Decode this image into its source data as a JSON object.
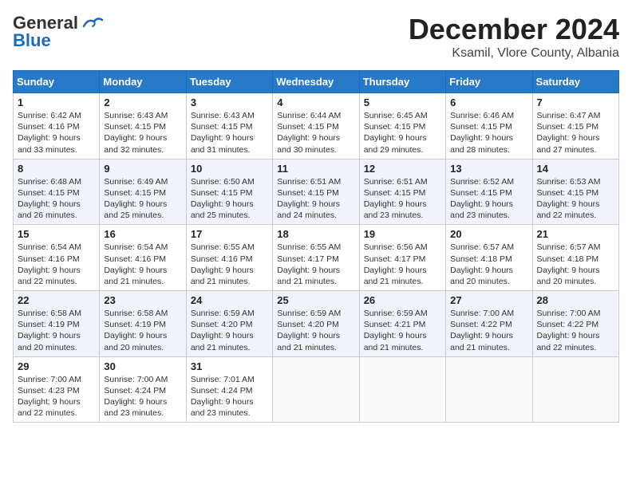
{
  "header": {
    "logo": {
      "line1": "General",
      "line2": "Blue"
    },
    "title": "December 2024",
    "subtitle": "Ksamil, Vlore County, Albania"
  },
  "calendar": {
    "weekdays": [
      "Sunday",
      "Monday",
      "Tuesday",
      "Wednesday",
      "Thursday",
      "Friday",
      "Saturday"
    ],
    "weeks": [
      [
        {
          "day": "",
          "info": ""
        },
        {
          "day": "2",
          "info": "Sunrise: 6:43 AM\nSunset: 4:15 PM\nDaylight: 9 hours\nand 32 minutes."
        },
        {
          "day": "3",
          "info": "Sunrise: 6:43 AM\nSunset: 4:15 PM\nDaylight: 9 hours\nand 31 minutes."
        },
        {
          "day": "4",
          "info": "Sunrise: 6:44 AM\nSunset: 4:15 PM\nDaylight: 9 hours\nand 30 minutes."
        },
        {
          "day": "5",
          "info": "Sunrise: 6:45 AM\nSunset: 4:15 PM\nDaylight: 9 hours\nand 29 minutes."
        },
        {
          "day": "6",
          "info": "Sunrise: 6:46 AM\nSunset: 4:15 PM\nDaylight: 9 hours\nand 28 minutes."
        },
        {
          "day": "7",
          "info": "Sunrise: 6:47 AM\nSunset: 4:15 PM\nDaylight: 9 hours\nand 27 minutes."
        }
      ],
      [
        {
          "day": "1",
          "info": "Sunrise: 6:42 AM\nSunset: 4:16 PM\nDaylight: 9 hours\nand 33 minutes."
        },
        {
          "day": "9",
          "info": "Sunrise: 6:49 AM\nSunset: 4:15 PM\nDaylight: 9 hours\nand 25 minutes."
        },
        {
          "day": "10",
          "info": "Sunrise: 6:50 AM\nSunset: 4:15 PM\nDaylight: 9 hours\nand 25 minutes."
        },
        {
          "day": "11",
          "info": "Sunrise: 6:51 AM\nSunset: 4:15 PM\nDaylight: 9 hours\nand 24 minutes."
        },
        {
          "day": "12",
          "info": "Sunrise: 6:51 AM\nSunset: 4:15 PM\nDaylight: 9 hours\nand 23 minutes."
        },
        {
          "day": "13",
          "info": "Sunrise: 6:52 AM\nSunset: 4:15 PM\nDaylight: 9 hours\nand 23 minutes."
        },
        {
          "day": "14",
          "info": "Sunrise: 6:53 AM\nSunset: 4:15 PM\nDaylight: 9 hours\nand 22 minutes."
        }
      ],
      [
        {
          "day": "8",
          "info": "Sunrise: 6:48 AM\nSunset: 4:15 PM\nDaylight: 9 hours\nand 26 minutes."
        },
        {
          "day": "16",
          "info": "Sunrise: 6:54 AM\nSunset: 4:16 PM\nDaylight: 9 hours\nand 21 minutes."
        },
        {
          "day": "17",
          "info": "Sunrise: 6:55 AM\nSunset: 4:16 PM\nDaylight: 9 hours\nand 21 minutes."
        },
        {
          "day": "18",
          "info": "Sunrise: 6:55 AM\nSunset: 4:17 PM\nDaylight: 9 hours\nand 21 minutes."
        },
        {
          "day": "19",
          "info": "Sunrise: 6:56 AM\nSunset: 4:17 PM\nDaylight: 9 hours\nand 21 minutes."
        },
        {
          "day": "20",
          "info": "Sunrise: 6:57 AM\nSunset: 4:18 PM\nDaylight: 9 hours\nand 20 minutes."
        },
        {
          "day": "21",
          "info": "Sunrise: 6:57 AM\nSunset: 4:18 PM\nDaylight: 9 hours\nand 20 minutes."
        }
      ],
      [
        {
          "day": "15",
          "info": "Sunrise: 6:54 AM\nSunset: 4:16 PM\nDaylight: 9 hours\nand 22 minutes."
        },
        {
          "day": "23",
          "info": "Sunrise: 6:58 AM\nSunset: 4:19 PM\nDaylight: 9 hours\nand 20 minutes."
        },
        {
          "day": "24",
          "info": "Sunrise: 6:59 AM\nSunset: 4:20 PM\nDaylight: 9 hours\nand 21 minutes."
        },
        {
          "day": "25",
          "info": "Sunrise: 6:59 AM\nSunset: 4:20 PM\nDaylight: 9 hours\nand 21 minutes."
        },
        {
          "day": "26",
          "info": "Sunrise: 6:59 AM\nSunset: 4:21 PM\nDaylight: 9 hours\nand 21 minutes."
        },
        {
          "day": "27",
          "info": "Sunrise: 7:00 AM\nSunset: 4:22 PM\nDaylight: 9 hours\nand 21 minutes."
        },
        {
          "day": "28",
          "info": "Sunrise: 7:00 AM\nSunset: 4:22 PM\nDaylight: 9 hours\nand 22 minutes."
        }
      ],
      [
        {
          "day": "22",
          "info": "Sunrise: 6:58 AM\nSunset: 4:19 PM\nDaylight: 9 hours\nand 20 minutes."
        },
        {
          "day": "30",
          "info": "Sunrise: 7:00 AM\nSunset: 4:24 PM\nDaylight: 9 hours\nand 23 minutes."
        },
        {
          "day": "31",
          "info": "Sunrise: 7:01 AM\nSunset: 4:24 PM\nDaylight: 9 hours\nand 23 minutes."
        },
        {
          "day": "",
          "info": ""
        },
        {
          "day": "",
          "info": ""
        },
        {
          "day": "",
          "info": ""
        },
        {
          "day": "",
          "info": ""
        }
      ],
      [
        {
          "day": "29",
          "info": "Sunrise: 7:00 AM\nSunset: 4:23 PM\nDaylight: 9 hours\nand 22 minutes."
        },
        {
          "day": "",
          "info": ""
        },
        {
          "day": "",
          "info": ""
        },
        {
          "day": "",
          "info": ""
        },
        {
          "day": "",
          "info": ""
        },
        {
          "day": "",
          "info": ""
        },
        {
          "day": "",
          "info": ""
        }
      ]
    ]
  }
}
